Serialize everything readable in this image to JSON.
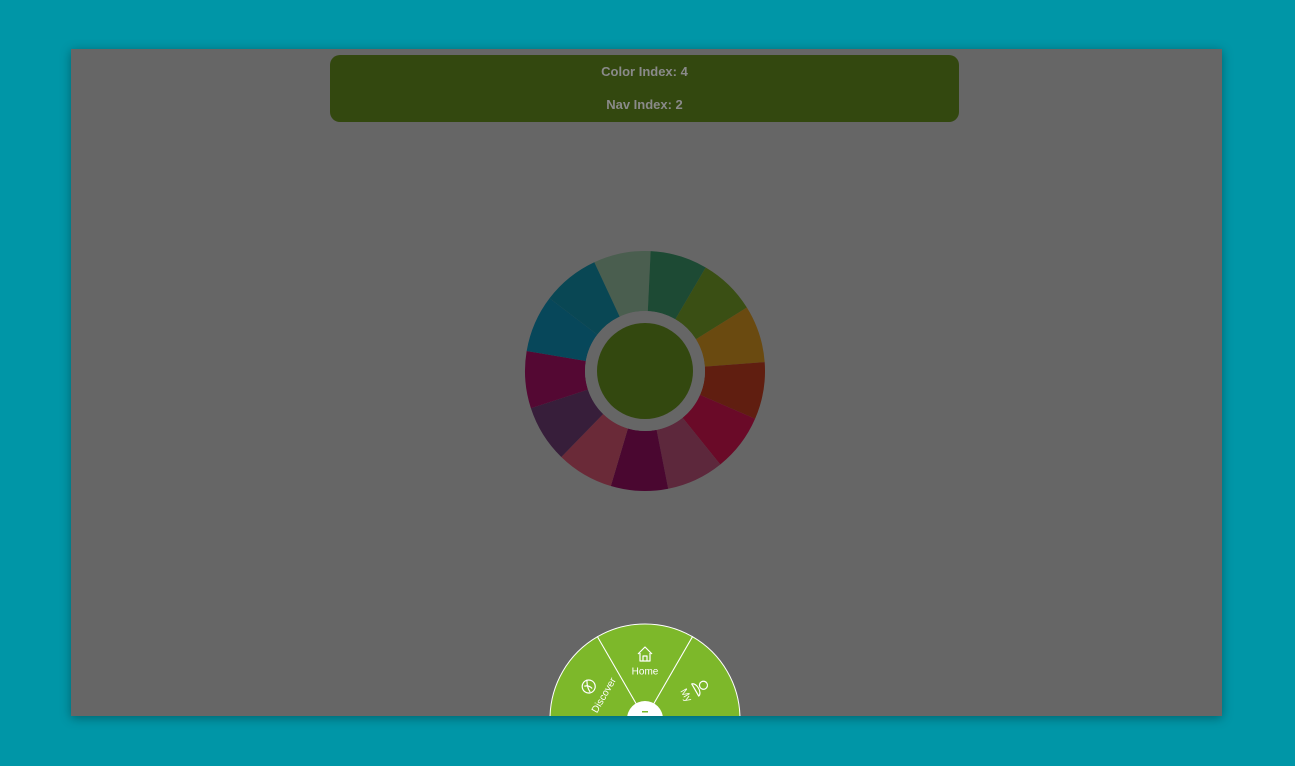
{
  "status": {
    "color_index_label": "Color Index: 4",
    "nav_index_label": "Nav Index: 2"
  },
  "color_wheel": {
    "center_color": "#33480f",
    "segments": [
      {
        "color": "#4a5e4f"
      },
      {
        "color": "#1d4a34"
      },
      {
        "color": "#3a4f14"
      },
      {
        "color": "#6a4a10"
      },
      {
        "color": "#601e10"
      },
      {
        "color": "#6a0a28"
      },
      {
        "color": "#5d283c"
      },
      {
        "color": "#4a0730"
      },
      {
        "color": "#6a2a38"
      },
      {
        "color": "#371e3a"
      },
      {
        "color": "#540833"
      },
      {
        "color": "#07475a"
      },
      {
        "color": "#094754"
      }
    ]
  },
  "nav_menu": {
    "accent_color": "#7db82a",
    "items": [
      {
        "label": "Discover",
        "icon": "leaf-icon"
      },
      {
        "label": "Home",
        "icon": "home-icon"
      },
      {
        "label": "My",
        "icon": "user-icon"
      }
    ]
  }
}
